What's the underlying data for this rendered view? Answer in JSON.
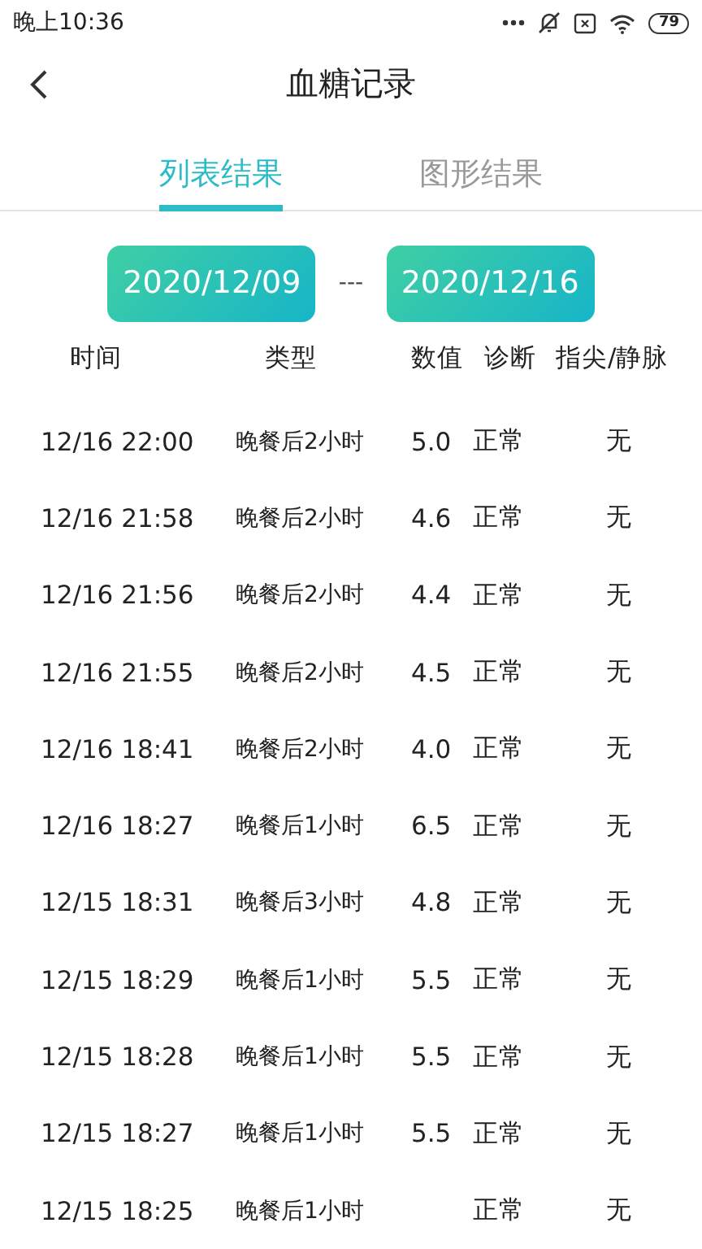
{
  "status_bar": {
    "time": "晚上10:36",
    "battery": "79"
  },
  "header": {
    "title": "血糖记录"
  },
  "tabs": [
    {
      "label": "列表结果",
      "selected": true
    },
    {
      "label": "图形结果",
      "selected": false
    }
  ],
  "date_range": {
    "start": "2020/12/09",
    "separator": "---",
    "end": "2020/12/16"
  },
  "table": {
    "columns": [
      "时间",
      "类型",
      "数值",
      "诊断",
      "指尖/静脉"
    ],
    "rows": [
      [
        "12/16  22:00",
        "晚餐后2小时",
        "5.0",
        "正常",
        "无"
      ],
      [
        "12/16  21:58",
        "晚餐后2小时",
        "4.6",
        "正常",
        "无"
      ],
      [
        "12/16  21:56",
        "晚餐后2小时",
        "4.4",
        "正常",
        "无"
      ],
      [
        "12/16  21:55",
        "晚餐后2小时",
        "4.5",
        "正常",
        "无"
      ],
      [
        "12/16  18:41",
        "晚餐后2小时",
        "4.0",
        "正常",
        "无"
      ],
      [
        "12/16  18:27",
        "晚餐后1小时",
        "6.5",
        "正常",
        "无"
      ],
      [
        "12/15  18:31",
        "晚餐后3小时",
        "4.8",
        "正常",
        "无"
      ],
      [
        "12/15  18:29",
        "晚餐后1小时",
        "5.5",
        "正常",
        "无"
      ],
      [
        "12/15  18:28",
        "晚餐后1小时",
        "5.5",
        "正常",
        "无"
      ],
      [
        "12/15  18:27",
        "晚餐后1小时",
        "5.5",
        "正常",
        "无"
      ],
      [
        "12/15  18:25",
        "晚餐后1小时",
        "",
        "正常",
        "无"
      ]
    ]
  }
}
